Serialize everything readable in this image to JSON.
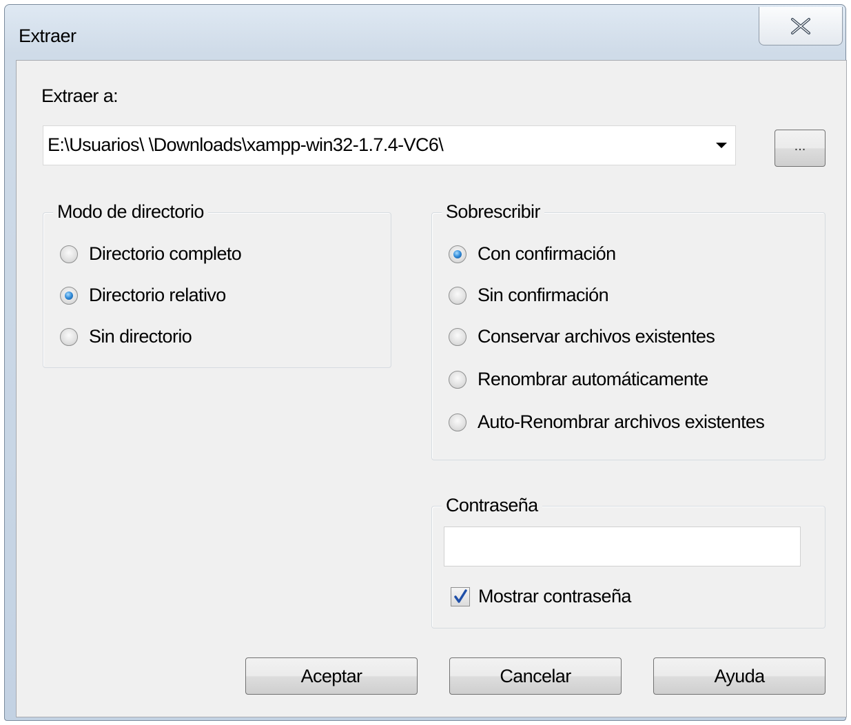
{
  "window": {
    "title": "Extraer"
  },
  "extract_to": {
    "label": "Extraer a:",
    "path_value": "E:\\Usuarios\\       \\Downloads\\xampp-win32-1.7.4-VC6\\",
    "browse_label": "..."
  },
  "directory_mode": {
    "title": "Modo de directorio",
    "options": [
      {
        "label": "Directorio completo",
        "checked": false
      },
      {
        "label": "Directorio relativo",
        "checked": true
      },
      {
        "label": "Sin directorio",
        "checked": false
      }
    ]
  },
  "overwrite": {
    "title": "Sobrescribir",
    "options": [
      {
        "label": "Con confirmación",
        "checked": true
      },
      {
        "label": "Sin confirmación",
        "checked": false
      },
      {
        "label": "Conservar archivos existentes",
        "checked": false
      },
      {
        "label": "Renombrar automáticamente",
        "checked": false
      },
      {
        "label": "Auto-Renombrar archivos existentes",
        "checked": false
      }
    ]
  },
  "password": {
    "title": "Contraseña",
    "value": "",
    "show_password_label": "Mostrar contraseña",
    "show_password_checked": true
  },
  "buttons": {
    "ok": "Aceptar",
    "cancel": "Cancelar",
    "help": "Ayuda"
  },
  "colors": {
    "radio_accent": "#2f8ad8",
    "check_accent": "#1f4fa8",
    "dialog_bg": "#f0f0f0"
  }
}
